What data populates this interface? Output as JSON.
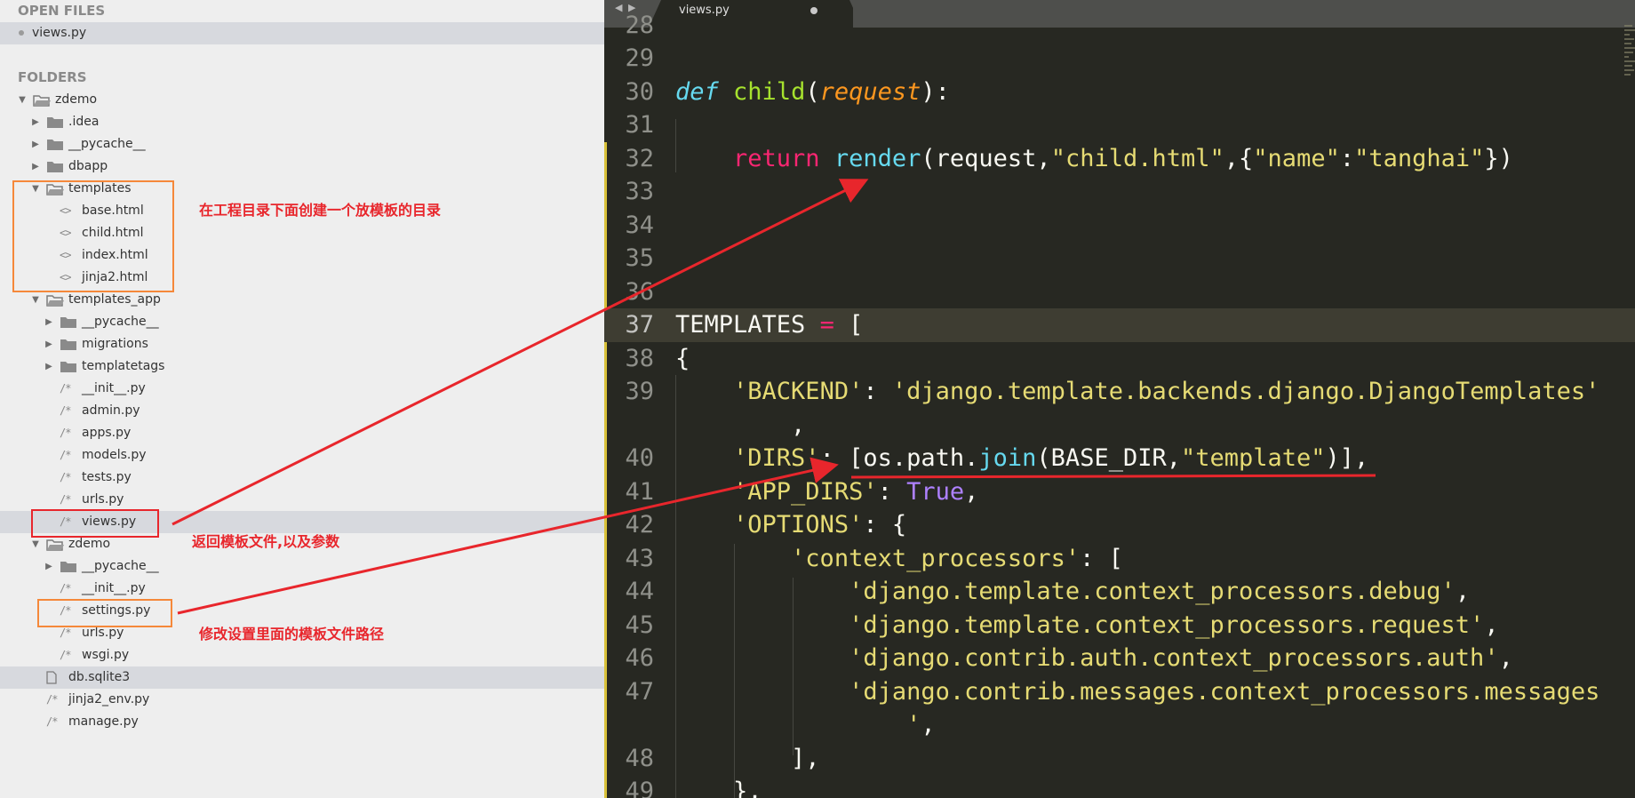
{
  "sidebar": {
    "open_files_title": "OPEN FILES",
    "open_file": "views.py",
    "folders_title": "FOLDERS",
    "tree": [
      {
        "label": "zdemo",
        "type": "folder-open",
        "indent": 0
      },
      {
        "label": ".idea",
        "type": "folder",
        "indent": 1
      },
      {
        "label": "__pycache__",
        "type": "folder",
        "indent": 1
      },
      {
        "label": "dbapp",
        "type": "folder",
        "indent": 1
      },
      {
        "label": "templates",
        "type": "folder-open",
        "indent": 1
      },
      {
        "label": "base.html",
        "type": "html",
        "indent": 2
      },
      {
        "label": "child.html",
        "type": "html",
        "indent": 2
      },
      {
        "label": "index.html",
        "type": "html",
        "indent": 2
      },
      {
        "label": "jinja2.html",
        "type": "html",
        "indent": 2
      },
      {
        "label": "templates_app",
        "type": "folder-open",
        "indent": 1
      },
      {
        "label": "__pycache__",
        "type": "folder",
        "indent": 2
      },
      {
        "label": "migrations",
        "type": "folder",
        "indent": 2
      },
      {
        "label": "templatetags",
        "type": "folder",
        "indent": 2
      },
      {
        "label": "__init__.py",
        "type": "py",
        "indent": 2
      },
      {
        "label": "admin.py",
        "type": "py",
        "indent": 2
      },
      {
        "label": "apps.py",
        "type": "py",
        "indent": 2
      },
      {
        "label": "models.py",
        "type": "py",
        "indent": 2
      },
      {
        "label": "tests.py",
        "type": "py",
        "indent": 2
      },
      {
        "label": "urls.py",
        "type": "py",
        "indent": 2
      },
      {
        "label": "views.py",
        "type": "py",
        "indent": 2,
        "selected": true
      },
      {
        "label": "zdemo",
        "type": "folder-open",
        "indent": 1
      },
      {
        "label": "__pycache__",
        "type": "folder",
        "indent": 2
      },
      {
        "label": "__init__.py",
        "type": "py",
        "indent": 2
      },
      {
        "label": "settings.py",
        "type": "py",
        "indent": 2
      },
      {
        "label": "urls.py",
        "type": "py",
        "indent": 2
      },
      {
        "label": "wsgi.py",
        "type": "py",
        "indent": 2
      },
      {
        "label": "db.sqlite3",
        "type": "file",
        "indent": 1,
        "highlight": true
      },
      {
        "label": "jinja2_env.py",
        "type": "py",
        "indent": 1
      },
      {
        "label": "manage.py",
        "type": "py",
        "indent": 1
      }
    ],
    "file_icon_html": "<>",
    "file_icon_py": "/*"
  },
  "tab": {
    "label": "views.py"
  },
  "editor": {
    "line_numbers": [
      "28",
      "29",
      "30",
      "31",
      "32",
      "33",
      "34",
      "35",
      "36",
      "37",
      "38",
      "39",
      "",
      "40",
      "41",
      "42",
      "43",
      "44",
      "45",
      "46",
      "47",
      "",
      "48",
      "49"
    ],
    "current_line": "37"
  },
  "annotations": {
    "templates_note": "在工程目录下面创建一个放模板的目录",
    "views_note": "返回模板文件,以及参数",
    "settings_note": "修改设置里面的模板文件路径"
  },
  "colors": {
    "annotation_red": "#e8262c",
    "annotation_orange": "#f5883a",
    "editor_bg": "#272822"
  }
}
